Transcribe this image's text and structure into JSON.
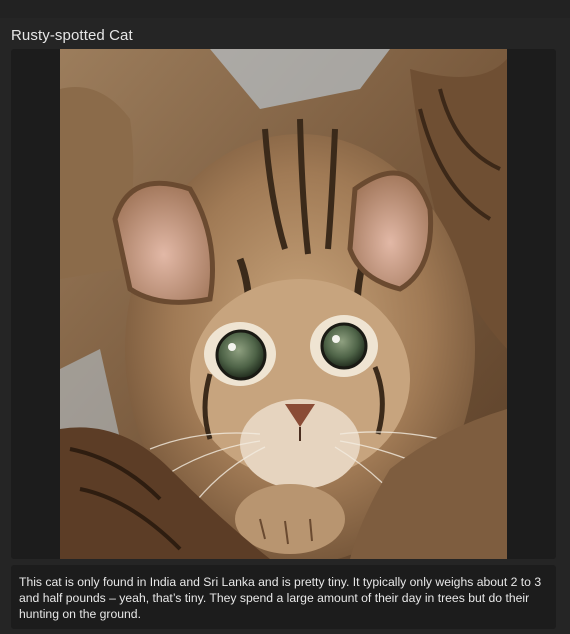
{
  "post": {
    "title": "Rusty-spotted Cat",
    "caption": "This cat is only found in India and Sri Lanka and is pretty tiny. It typically only weighs about 2 to 3 and half pounds – yeah, that’s tiny. They spend a large amount of their day in trees but do their hunting on the ground.",
    "photo_subject": "rusty-spotted kitten on a tree branch"
  },
  "colors": {
    "page_background": "#252525",
    "panel_background": "#1c1c1c",
    "text": "#e6e6e6"
  }
}
